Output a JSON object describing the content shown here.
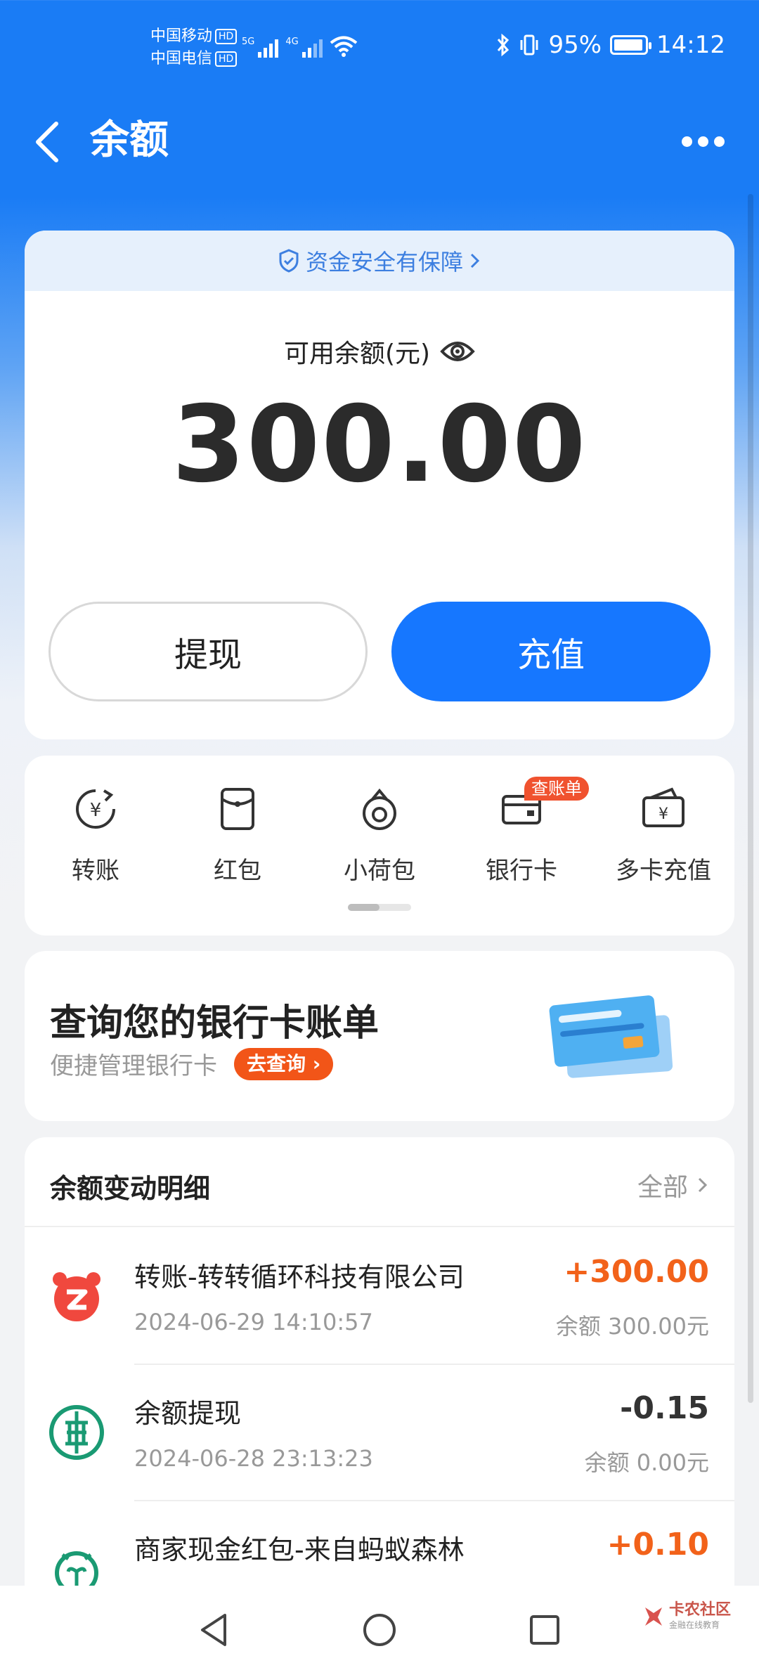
{
  "status_bar": {
    "carrier1": "中国移动",
    "carrier2": "中国电信",
    "hd": "HD",
    "net1": "5G",
    "net2": "4G",
    "battery": "95%",
    "time": "14:12"
  },
  "header": {
    "title": "余额"
  },
  "balance_card": {
    "safety_text": "资金安全有保障",
    "label": "可用余额(元)",
    "amount": "300.00",
    "withdraw_label": "提现",
    "recharge_label": "充值"
  },
  "shortcuts": [
    {
      "label": "转账",
      "icon": "transfer-icon"
    },
    {
      "label": "红包",
      "icon": "red-packet-icon"
    },
    {
      "label": "小荷包",
      "icon": "small-pouch-icon"
    },
    {
      "label": "银行卡",
      "icon": "bank-card-icon",
      "badge": "查账单"
    },
    {
      "label": "多卡充值",
      "icon": "multi-card-recharge-icon"
    }
  ],
  "promo": {
    "title": "查询您的银行卡账单",
    "subtitle": "便捷管理银行卡",
    "button": "去查询"
  },
  "transactions": {
    "title": "余额变动明细",
    "all_label": "全部",
    "items": [
      {
        "name": "转账-转转循环科技有限公司",
        "time": "2024-06-29 14:10:57",
        "amount": "+300.00",
        "balance": "余额 300.00元",
        "icon": "zhuanzhuan-logo-icon",
        "color": "#f0483e"
      },
      {
        "name": "余额提现",
        "time": "2024-06-28 23:13:23",
        "amount": "-0.15",
        "balance": "余额 0.00元",
        "icon": "abc-bank-logo-icon",
        "color": "#1a9a73"
      },
      {
        "name": "商家现金红包-来自蚂蚁森林",
        "time": "",
        "amount": "+0.10",
        "balance": "",
        "icon": "ant-forest-logo-icon",
        "color": "#1a9a73"
      }
    ]
  },
  "watermark": {
    "main": "卡农社区",
    "sub": "金融在线教育"
  },
  "colors": {
    "primary": "#1677ff",
    "positive": "#f2621a",
    "promo_button": "#f25518"
  }
}
